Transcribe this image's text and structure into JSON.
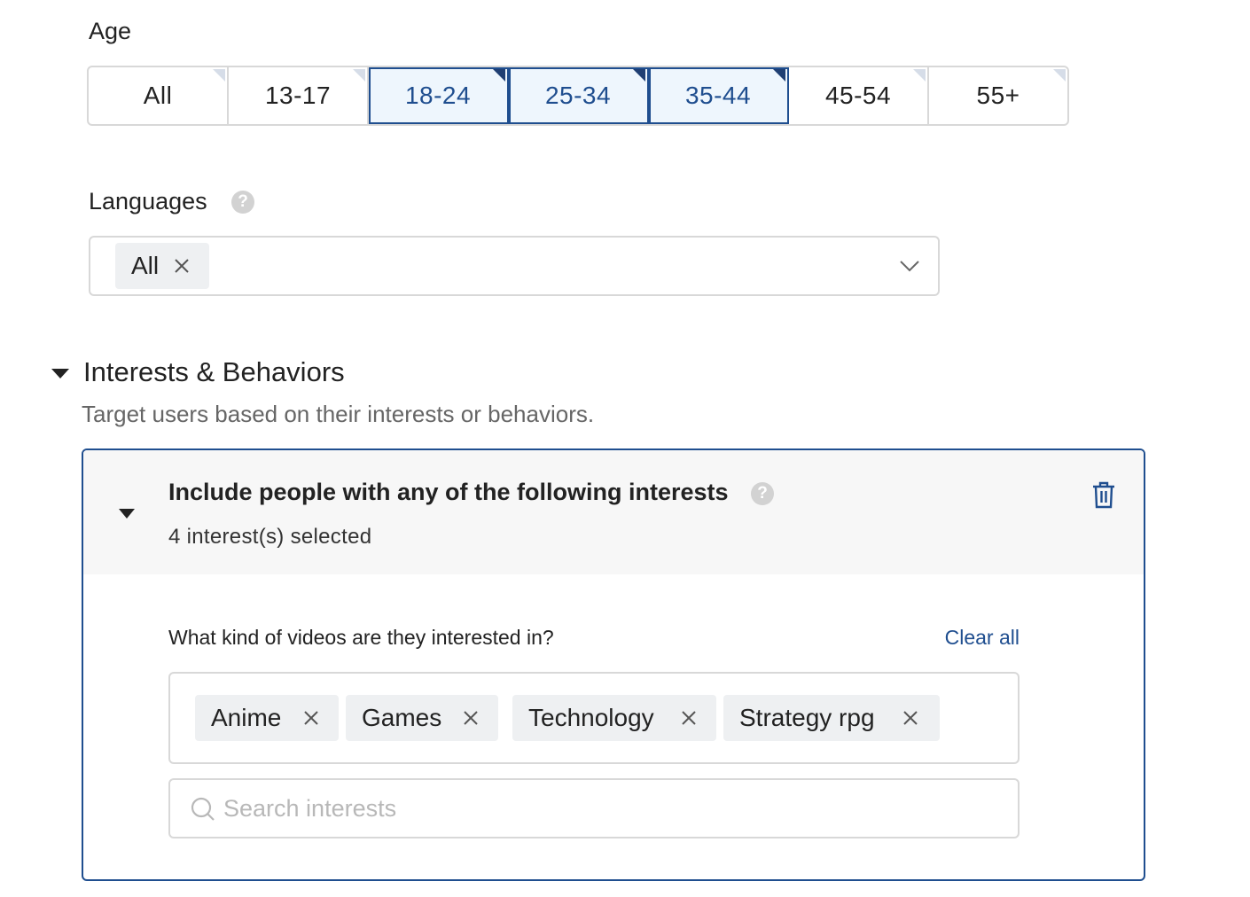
{
  "age": {
    "label": "Age",
    "options": [
      {
        "label": "All",
        "selected": false
      },
      {
        "label": "13-17",
        "selected": false
      },
      {
        "label": "18-24",
        "selected": true
      },
      {
        "label": "25-34",
        "selected": true
      },
      {
        "label": "35-44",
        "selected": true
      },
      {
        "label": "45-54",
        "selected": false
      },
      {
        "label": "55+",
        "selected": false
      }
    ]
  },
  "languages": {
    "label": "Languages",
    "help_glyph": "?",
    "selected_chip": "All"
  },
  "interests_section": {
    "title": "Interests & Behaviors",
    "subtitle": "Target users based on their interests or behaviors.",
    "card": {
      "title": "Include people with any of the following interests",
      "help_glyph": "?",
      "count_text": "4 interest(s) selected",
      "question": "What kind of videos are they interested in?",
      "clear_all": "Clear all",
      "tags": [
        "Anime",
        "Games",
        "Technology",
        "Strategy rpg"
      ],
      "search_placeholder": "Search interests"
    }
  },
  "colors": {
    "accent": "#1f4e8f",
    "selected_bg": "#eef6fd",
    "chip_bg": "#eef0f2",
    "border": "#d8d8d8"
  },
  "icons": {
    "chip_remove": "close-icon",
    "dropdown": "chevron-down-icon",
    "help": "help-icon",
    "delete": "trash-icon",
    "search": "search-icon",
    "collapse": "caret-down-icon"
  }
}
